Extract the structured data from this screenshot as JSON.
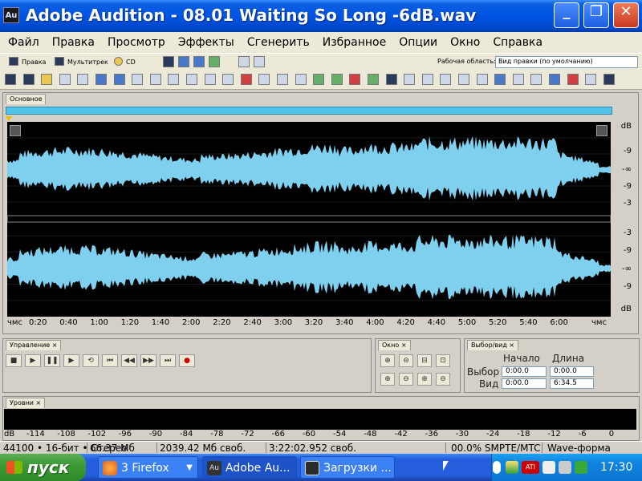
{
  "window": {
    "icon_text": "Au",
    "title": "Adobe Audition - 08.01 Waiting So Long -6dB.wav",
    "minimize": "_",
    "maximize": "❐",
    "close": "✕"
  },
  "menu": [
    "Файл",
    "Правка",
    "Просмотр",
    "Эффекты",
    "Сгенерить",
    "Избранное",
    "Опции",
    "Окно",
    "Справка"
  ],
  "toolbar1": {
    "edit_view": "Правка",
    "multitrack_view": "Мультитрек",
    "cd_view": "CD",
    "workspace_label": "Рабочая область:",
    "workspace_value": "Вид правки (по умолчанию)"
  },
  "main_panel": {
    "tab": "Основное",
    "db_top": [
      "dB",
      "-9",
      "-∞",
      "-9",
      "-3"
    ],
    "db_bottom": [
      "-3",
      "-9",
      "-∞",
      "-9",
      "dB"
    ],
    "time_ticks": [
      "чмс",
      "0:20",
      "0:40",
      "1:00",
      "1:20",
      "1:40",
      "2:00",
      "2:20",
      "2:40",
      "3:00",
      "3:20",
      "3:40",
      "4:00",
      "4:20",
      "4:40",
      "5:00",
      "5:20",
      "5:40",
      "6:00",
      "чмс"
    ]
  },
  "transport": {
    "tab": "Управление",
    "close": "×",
    "buttons": [
      "■",
      "▶",
      "❚❚",
      "▶",
      "⟲",
      "⏮",
      "◀◀",
      "▶▶",
      "⏭",
      "●"
    ]
  },
  "zoom": {
    "tab": "Окно",
    "close": "×"
  },
  "selection": {
    "tab": "Выбор/вид",
    "close": "×",
    "col_start": "Начало",
    "col_length": "Длина",
    "row_selection": "Выбор",
    "row_view": "Вид",
    "sel_start": "0:00.0",
    "sel_length": "0:00.0",
    "view_start": "0:00.0",
    "view_length": "6:34.5"
  },
  "levels": {
    "tab": "Уровни",
    "close": "×",
    "scale": [
      "dB",
      "-114",
      "-108",
      "-102",
      "-96",
      "-90",
      "-84",
      "-78",
      "-72",
      "-66",
      "-60",
      "-54",
      "-48",
      "-42",
      "-36",
      "-30",
      "-24",
      "-18",
      "-12",
      "-6",
      "0"
    ]
  },
  "status": {
    "format": "44100 • 16-бит • Стерео",
    "file_size": "66.37 Мб",
    "free_space": "2039.42 Мб своб.",
    "free_time": "3:22:02.952 своб.",
    "smpte": "00.0% SMPTE/MTC",
    "view_mode": "Wave-форма"
  },
  "taskbar": {
    "start": "пуск",
    "tasks": [
      "3 Firefox",
      "Adobe Au...",
      "Загрузки ..."
    ],
    "clock": "17:30"
  },
  "colors": {
    "waveform": "#7fd0ef",
    "wave_bg": "#000000",
    "overview": "#4fc3e8"
  }
}
